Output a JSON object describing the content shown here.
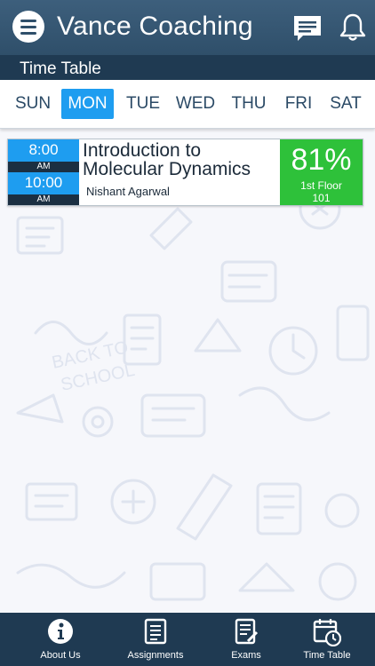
{
  "header": {
    "title": "Vance Coaching",
    "menu_icon": "hamburger-menu-icon",
    "chat_icon": "chat-icon",
    "notification_icon": "bell-icon"
  },
  "subheader": {
    "title": "Time Table"
  },
  "days": [
    {
      "label": "SUN",
      "active": false
    },
    {
      "label": "MON",
      "active": true
    },
    {
      "label": "TUE",
      "active": false
    },
    {
      "label": "WED",
      "active": false
    },
    {
      "label": "THU",
      "active": false
    },
    {
      "label": "FRI",
      "active": false
    },
    {
      "label": "SAT",
      "active": false
    }
  ],
  "classes": [
    {
      "start_time": "8:00",
      "start_ampm": "AM",
      "end_time": "10:00",
      "end_ampm": "AM",
      "course": "Introduction to Molecular Dynamics",
      "teacher": "Nishant Agarwal",
      "attendance": "81%",
      "room_line1": "1st Floor",
      "room_line2": "101"
    }
  ],
  "bottom_nav": [
    {
      "label": "About Us",
      "icon": "info-icon"
    },
    {
      "label": "Assignments",
      "icon": "assignment-icon"
    },
    {
      "label": "Exams",
      "icon": "exam-icon"
    },
    {
      "label": "Time Table",
      "icon": "calendar-clock-icon"
    }
  ],
  "colors": {
    "header": "#2f4f6a",
    "subheader": "#1f3a52",
    "accent_blue": "#1e9df0",
    "attendance_green": "#2ec13a"
  }
}
